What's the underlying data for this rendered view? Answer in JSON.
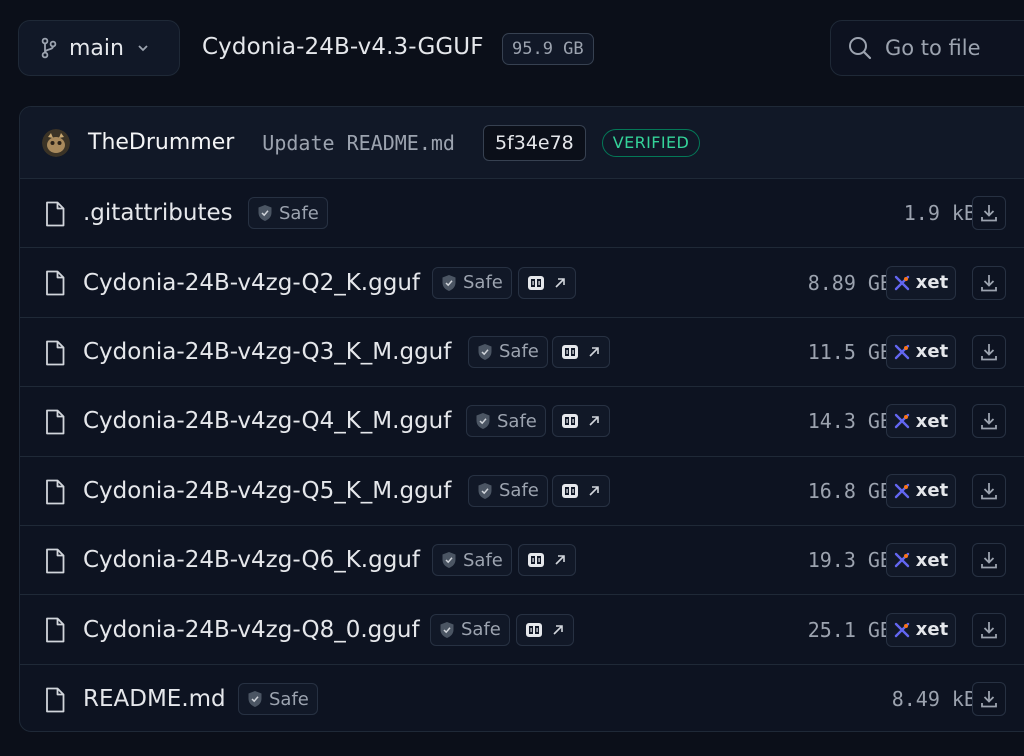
{
  "topbar": {
    "branch": "main",
    "repo_name": "Cydonia-24B-v4.3-GGUF",
    "repo_size": "95.9 GB",
    "search_placeholder": "Go to file"
  },
  "commit": {
    "author": "TheDrummer",
    "message": "Update README.md",
    "sha": "5f34e78",
    "verified_label": "VERIFIED"
  },
  "colors": {
    "background": "#0b0f19",
    "verified": "#34d399",
    "xet_blue": "#6366f1",
    "xet_orange": "#f97316"
  },
  "files": [
    {
      "name": ".gitattributes",
      "safe_label": "Safe",
      "size": "1.9 kB"
    },
    {
      "name": "Cydonia-24B-v4zg-Q2_K.gguf",
      "safe_label": "Safe",
      "size": "8.89 GB",
      "storage": "xet"
    },
    {
      "name": "Cydonia-24B-v4zg-Q3_K_M.gguf",
      "safe_label": "Safe",
      "size": "11.5 GB",
      "storage": "xet"
    },
    {
      "name": "Cydonia-24B-v4zg-Q4_K_M.gguf",
      "safe_label": "Safe",
      "size": "14.3 GB",
      "storage": "xet"
    },
    {
      "name": "Cydonia-24B-v4zg-Q5_K_M.gguf",
      "safe_label": "Safe",
      "size": "16.8 GB",
      "storage": "xet"
    },
    {
      "name": "Cydonia-24B-v4zg-Q6_K.gguf",
      "safe_label": "Safe",
      "size": "19.3 GB",
      "storage": "xet"
    },
    {
      "name": "Cydonia-24B-v4zg-Q8_0.gguf",
      "safe_label": "Safe",
      "size": "25.1 GB",
      "storage": "xet"
    },
    {
      "name": "README.md",
      "safe_label": "Safe",
      "size": "8.49 kB"
    }
  ]
}
